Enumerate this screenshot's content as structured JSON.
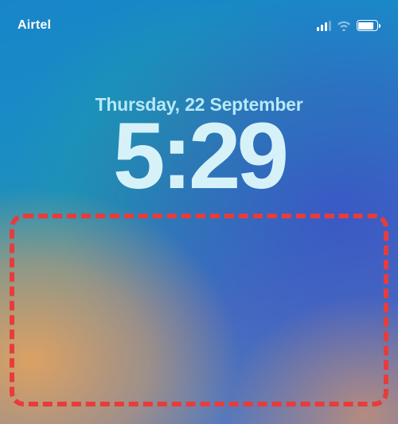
{
  "statusBar": {
    "carrier": "Airtel"
  },
  "lockScreen": {
    "date": "Thursday, 22 September",
    "time": "5:29"
  }
}
